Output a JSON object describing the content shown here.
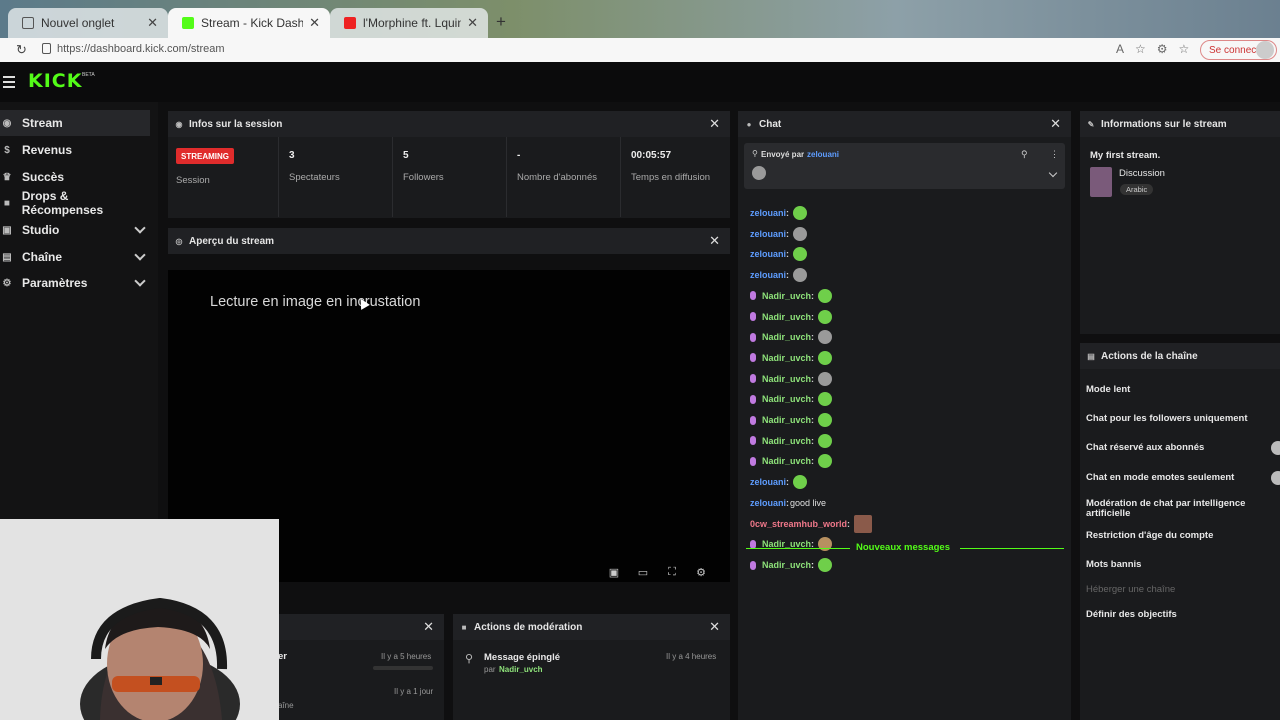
{
  "browser": {
    "tabs": [
      {
        "title": "Nouvel onglet",
        "active": false
      },
      {
        "title": "Stream - Kick Dashboard",
        "active": true
      },
      {
        "title": "l'Morphine ft. Lquinze - DIAM",
        "active": false
      }
    ],
    "url": "https://dashboard.kick.com/stream",
    "signin_label": "Se connecter"
  },
  "header": {
    "logo": "KICK",
    "beta": "BETA"
  },
  "sidebar": {
    "items": [
      {
        "label": "Stream",
        "icon": "broadcast-icon"
      },
      {
        "label": "Revenus",
        "icon": "dollar-icon"
      },
      {
        "label": "Succès",
        "icon": "trophy-icon"
      },
      {
        "label": "Drops & Récompenses",
        "icon": "gift-icon"
      },
      {
        "label": "Studio",
        "icon": "studio-icon"
      },
      {
        "label": "Chaîne",
        "icon": "channel-icon"
      },
      {
        "label": "Paramètres",
        "icon": "gear-icon"
      }
    ]
  },
  "session": {
    "title": "Infos sur la session",
    "badge": "STREAMING",
    "badge_label": "Session",
    "stats": [
      {
        "value": "3",
        "label": "Spectateurs"
      },
      {
        "value": "5",
        "label": "Followers"
      },
      {
        "value": "-",
        "label": "Nombre d'abonnés"
      },
      {
        "value": "00:05:57",
        "label": "Temps en diffusion"
      }
    ]
  },
  "preview": {
    "title": "Aperçu du stream",
    "pip_text": "Lecture en image en incrustation"
  },
  "activity": {
    "item1_tail": "er",
    "item1_time": "Il y a 5 heures",
    "item2_time": "Il y a 1 jour",
    "item2_tail": "aîne"
  },
  "moderation": {
    "title": "Actions de modération",
    "item_title": "Message épinglé",
    "item_by": "par",
    "item_user": "Nadir_uvch",
    "item_time": "Il y a 4 heures"
  },
  "chat": {
    "title": "Chat",
    "pinned_prefix": "Envoyé par",
    "pinned_user": "zelouani",
    "messages": [
      {
        "user": "zelouani",
        "type": "blue",
        "emote": "green"
      },
      {
        "user": "zelouani",
        "type": "blue",
        "emote": "gray"
      },
      {
        "user": "zelouani",
        "type": "blue",
        "emote": "green"
      },
      {
        "user": "zelouani",
        "type": "blue",
        "emote": "gray"
      },
      {
        "user": "Nadir_uvch",
        "type": "green",
        "emote": "green"
      },
      {
        "user": "Nadir_uvch",
        "type": "green",
        "emote": "green"
      },
      {
        "user": "Nadir_uvch",
        "type": "green",
        "emote": "gray"
      },
      {
        "user": "Nadir_uvch",
        "type": "green",
        "emote": "green"
      },
      {
        "user": "Nadir_uvch",
        "type": "green",
        "emote": "gray"
      },
      {
        "user": "Nadir_uvch",
        "type": "green",
        "emote": "green"
      },
      {
        "user": "Nadir_uvch",
        "type": "green",
        "emote": "green"
      },
      {
        "user": "Nadir_uvch",
        "type": "green",
        "emote": "green"
      },
      {
        "user": "Nadir_uvch",
        "type": "green",
        "emote": "green"
      },
      {
        "user": "zelouani",
        "type": "blue",
        "emote": "green"
      },
      {
        "user": "zelouani",
        "type": "blue",
        "text": "good live"
      },
      {
        "user": "0cw_streamhub_world",
        "type": "pink",
        "emote": "photo"
      },
      {
        "user": "Nadir_uvch",
        "type": "green",
        "emote": "mix"
      }
    ],
    "new_messages_label": "Nouveaux messages",
    "after_divider": {
      "user": "Nadir_uvch",
      "type": "green",
      "emote": "green"
    }
  },
  "stream_info": {
    "title": "Informations sur le stream",
    "stream_title": "My first stream.",
    "category": "Discussion",
    "language": "Arabic"
  },
  "channel_actions": {
    "title": "Actions de la chaîne",
    "items": [
      {
        "label": "Mode lent",
        "enabled": true
      },
      {
        "label": "Chat pour les followers uniquement",
        "enabled": true
      },
      {
        "label": "Chat réservé aux abonnés",
        "enabled": true,
        "toggle": true
      },
      {
        "label": "Chat en mode emotes seulement",
        "enabled": true,
        "toggle": true
      },
      {
        "label": "Modération de chat par intelligence artificielle",
        "enabled": true
      },
      {
        "label": "Restriction d'âge du compte",
        "enabled": true
      },
      {
        "label": "Mots bannis",
        "enabled": true
      },
      {
        "label": "Héberger une chaîne",
        "enabled": false
      },
      {
        "label": "Définir des objectifs",
        "enabled": true
      }
    ]
  },
  "colors": {
    "kick_green": "#53fc18",
    "live_red": "#e02c2c",
    "username_blue": "#5e9dff",
    "username_green": "#8ee27a"
  }
}
